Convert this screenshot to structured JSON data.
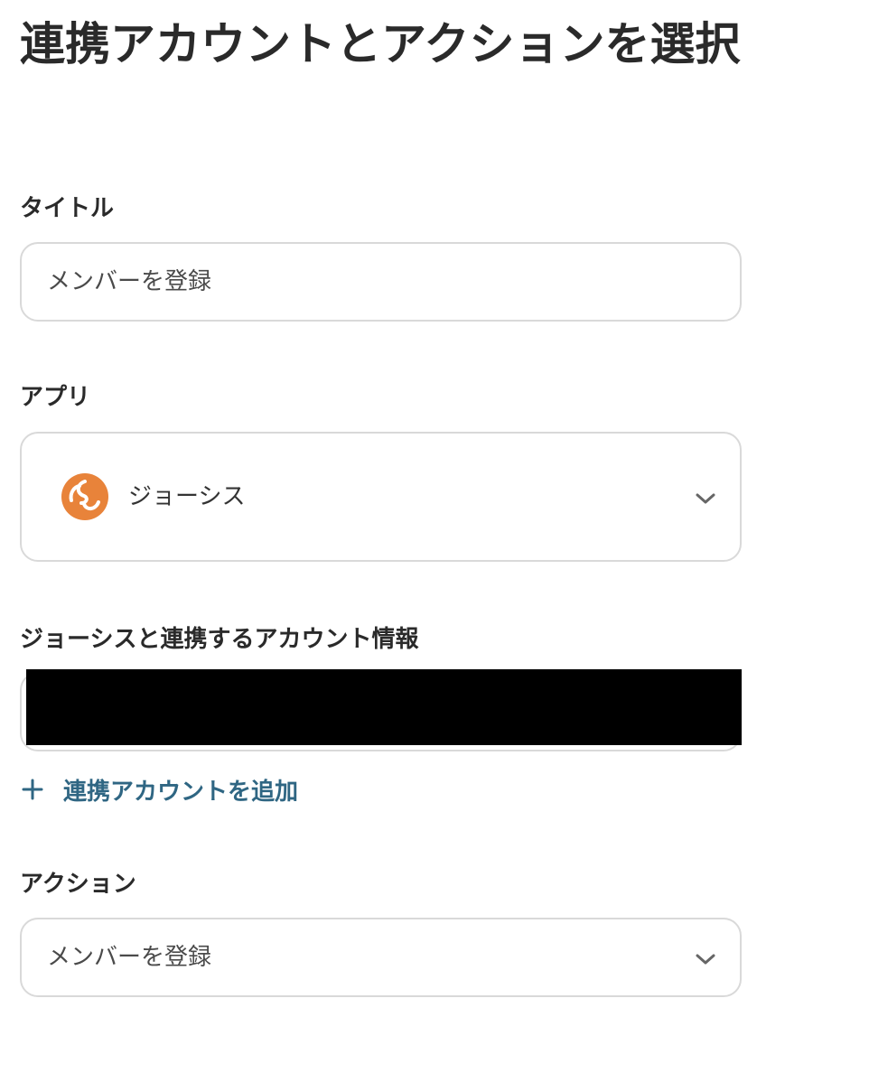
{
  "page": {
    "title": "連携アカウントとアクションを選択"
  },
  "title_field": {
    "label": "タイトル",
    "value": "メンバーを登録"
  },
  "app_field": {
    "label": "アプリ",
    "selected": "ジョーシス",
    "icon": "josys-logo-icon",
    "brand_color": "#e8833a"
  },
  "account_field": {
    "label": "ジョーシスと連携するアカウント情報",
    "value": ""
  },
  "add_account": {
    "label": "連携アカウントを追加",
    "icon": "plus-icon",
    "color": "#2f6683"
  },
  "action_field": {
    "label": "アクション",
    "selected": "メンバーを登録"
  }
}
